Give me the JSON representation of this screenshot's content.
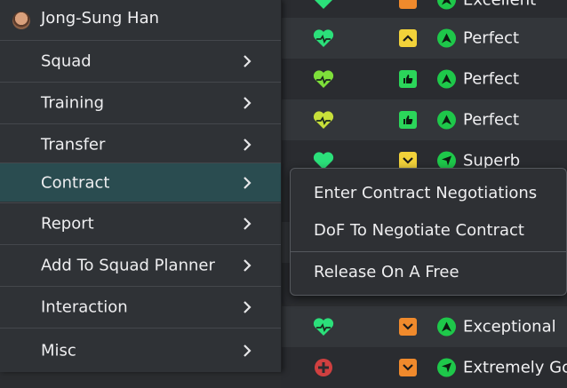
{
  "menu": {
    "player_name": "Jong-Sung Han",
    "items": [
      {
        "label": "Squad"
      },
      {
        "label": "Training"
      },
      {
        "label": "Transfer"
      },
      {
        "label": "Contract"
      },
      {
        "label": "Report"
      },
      {
        "label": "Add To Squad Planner"
      },
      {
        "label": "Interaction"
      },
      {
        "label": "Misc"
      }
    ]
  },
  "submenu": {
    "items": [
      {
        "label": "Enter Contract Negotiations"
      },
      {
        "label": "DoF To Negotiate Contract"
      },
      {
        "label": "Release On A Free"
      }
    ]
  },
  "table": {
    "rows": [
      {
        "status": "Excellent",
        "heart_color": "#2be07a",
        "morale_color": "#f08a2c"
      },
      {
        "status": "Perfect",
        "heart_color": "#2be07a",
        "morale_color": "#f2d23a"
      },
      {
        "status": "Perfect",
        "heart_color": "#7ee03a",
        "morale_color": "#2bd65a"
      },
      {
        "status": "Perfect",
        "heart_color": "#c8e03a",
        "morale_color": "#2bd65a"
      },
      {
        "status": "Superb",
        "heart_color": "#2be07a",
        "morale_color": "#f2d23a"
      },
      {
        "status": "Exceptional",
        "heart_color": "#2be07a",
        "morale_color": "#f08a2c"
      },
      {
        "status": "Extremely Go",
        "heart_color": "#d04040",
        "morale_color": "#f08a2c"
      }
    ]
  },
  "colors": {
    "arrow": "#1ec84a",
    "active_item": "#2a4c50"
  }
}
